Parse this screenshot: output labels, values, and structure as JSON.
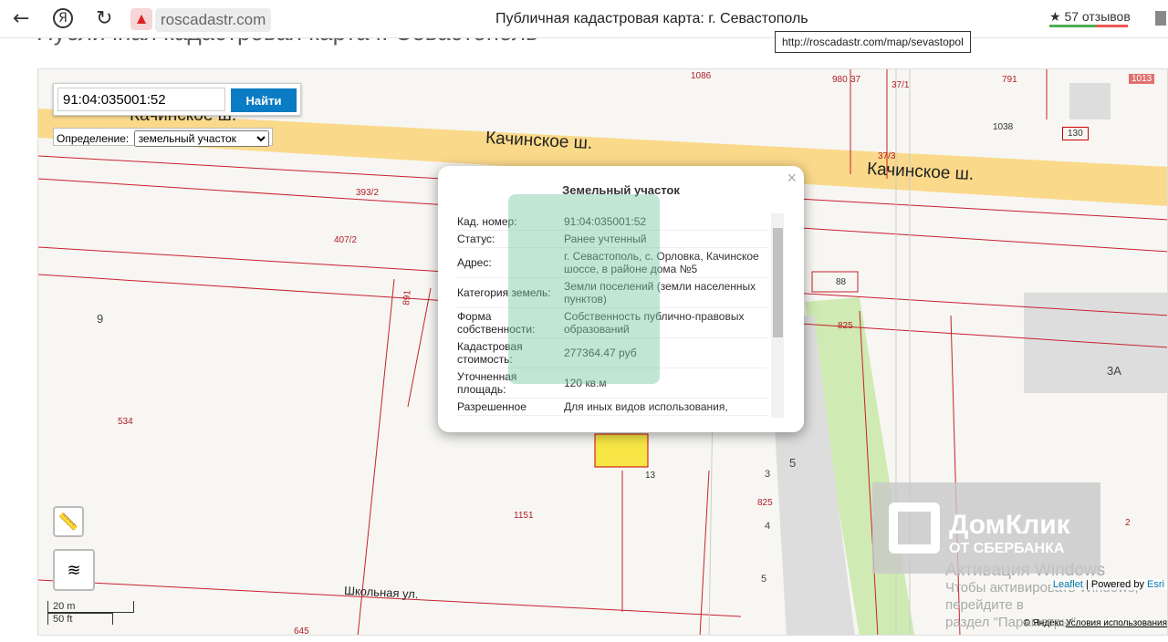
{
  "browser": {
    "host": "roscadastr.com",
    "title": "Публичная кадастровая карта: г. Севастополь",
    "reviews": "★ 57 отзывов",
    "tooltip": "http://roscadastr.com/map/sevastopol",
    "back": "←",
    "ya": "Я",
    "reload": "↻"
  },
  "page": {
    "heading": "Публичная кадастровая карта г. Севастополь"
  },
  "search": {
    "value": "91:04:035001:52",
    "button": "Найти",
    "def_label": "Определение:",
    "def_value": "земельный участок"
  },
  "map": {
    "roads": [
      "Качинское ш.",
      "Качинское ш.",
      "Качинское ш.",
      "Школьная ул."
    ],
    "labels": [
      "1086",
      "980",
      "37",
      "37/1",
      "791",
      "1013",
      "1038",
      "130",
      "37/3",
      "393/2",
      "407/2",
      "891",
      "88",
      "825",
      "825",
      "534",
      "1151",
      "645",
      "2",
      "13"
    ],
    "gray": [
      "9",
      "3А",
      "5",
      "3",
      "4",
      "5"
    ]
  },
  "popup": {
    "title": "Земельный участок",
    "close": "×",
    "rows": [
      {
        "k": "Кад. номер:",
        "v": "91:04:035001:52"
      },
      {
        "k": "Статус:",
        "v": "Ранее учтенный"
      },
      {
        "k": "Адрес:",
        "v": "г. Севастополь, с. Орловка, Качинское шоссе, в районе дома №5"
      },
      {
        "k": "Категория земель:",
        "v": "Земли поселений (земли населенных пунктов)"
      },
      {
        "k": "Форма собственности:",
        "v": "Собственность публично-правовых образований"
      },
      {
        "k": "Кадастровая стоимость:",
        "v": "277364.47 руб"
      },
      {
        "k": "Уточненная площадь:",
        "v": "120 кв.м"
      },
      {
        "k": "Разрешенное",
        "v": "Для иных видов использования,"
      }
    ]
  },
  "watermarks": {
    "domclick": "ДомКлик",
    "domclick_sub": "ОТ СБЕРБАНКА",
    "windows1": "Активация Windows",
    "windows2": "Чтобы активировать Windows, перейдите в",
    "windows3": "раздел \"Параметры\"."
  },
  "attribution": {
    "leaflet": "Leaflet",
    "powered": "| Powered by",
    "esri": "Esri",
    "yandex": "© Яндекс",
    "terms": "Условия использования"
  },
  "scale": {
    "m": "20 m",
    "ft": "50 ft"
  }
}
